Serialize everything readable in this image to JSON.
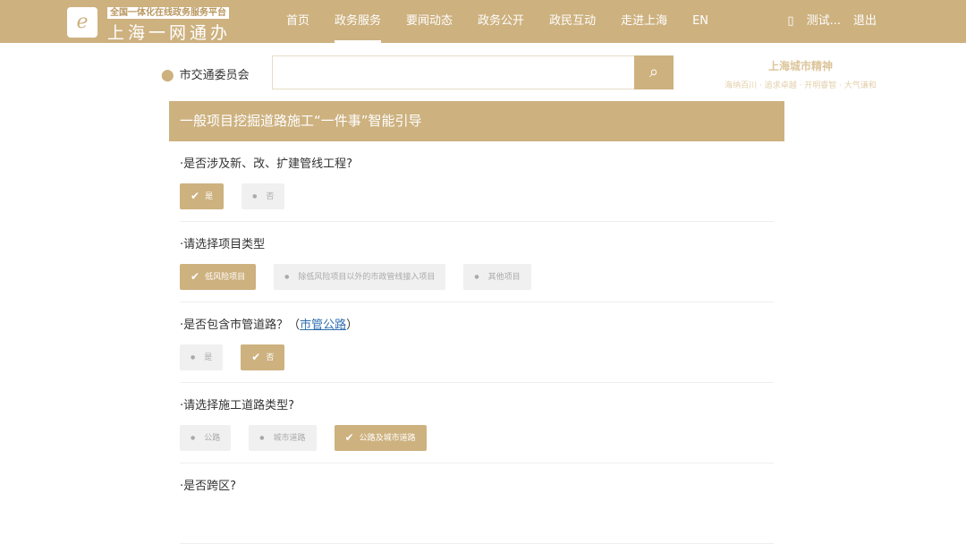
{
  "header": {
    "slogan": "全国一体化在线政务服务平台",
    "brand": "上海一网通办",
    "nav": [
      "首页",
      "政务服务",
      "要闻动态",
      "政务公开",
      "政民互动",
      "走进上海",
      "EN"
    ],
    "active": 1,
    "user": "测试...",
    "logout": "退出"
  },
  "search": {
    "location": "市交通委员会",
    "placeholder": ""
  },
  "spirit": {
    "title": "上海城市精神",
    "subtitle": "海纳百川 · 追求卓越 · 开明睿智 · 大气谦和"
  },
  "panel": {
    "title": "一般项目挖掘道路施工“一件事”智能引导",
    "questions": [
      {
        "label": "·是否涉及新、改、扩建管线工程?",
        "options": [
          {
            "text": "是",
            "selected": true
          },
          {
            "text": "否",
            "selected": false
          }
        ]
      },
      {
        "label": "·请选择项目类型",
        "options": [
          {
            "text": "低风险项目",
            "selected": true
          },
          {
            "text": "除低风险项目以外的市政管线接入项目",
            "selected": false
          },
          {
            "text": "其他项目",
            "selected": false
          }
        ]
      },
      {
        "label": "·是否包含市管道路？（",
        "link": "市管公路",
        "suffix": "）",
        "options": [
          {
            "text": "是",
            "selected": false
          },
          {
            "text": "否",
            "selected": true
          }
        ]
      },
      {
        "label": "·请选择施工道路类型?",
        "options": [
          {
            "text": "公路",
            "selected": false
          },
          {
            "text": "城市道路",
            "selected": false
          },
          {
            "text": "公路及城市道路",
            "selected": true
          }
        ]
      },
      {
        "label": "·是否跨区?",
        "options": []
      }
    ]
  }
}
